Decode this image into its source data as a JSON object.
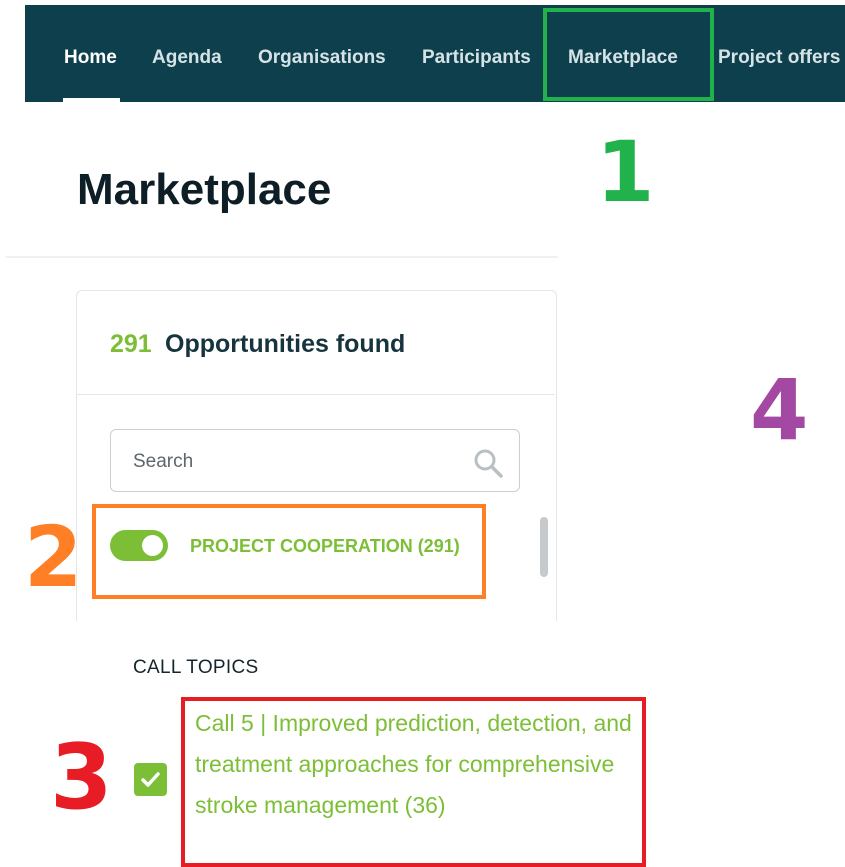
{
  "nav": {
    "items": [
      {
        "label": "Home",
        "active": true
      },
      {
        "label": "Agenda"
      },
      {
        "label": "Organisations"
      },
      {
        "label": "Participants"
      },
      {
        "label": "Marketplace"
      },
      {
        "label": "Project offers"
      }
    ]
  },
  "page": {
    "title": "Marketplace"
  },
  "filters": {
    "count": "291",
    "count_label": "Opportunities found",
    "search": {
      "placeholder": "Search",
      "value": ""
    },
    "toggle": {
      "label": "PROJECT COOPERATION (291)",
      "checked": true
    }
  },
  "call_topics": {
    "heading": "CALL TOPICS",
    "items": [
      {
        "label": "Call 5 | Improved prediction, detection, and treatment approaches for comprehensive stroke management (36)",
        "checked": true
      }
    ]
  },
  "annotations": {
    "markers": [
      "1",
      "2",
      "3",
      "4"
    ],
    "colors": [
      "#22b24c",
      "#ff7f27",
      "#e81c24",
      "#a349a4"
    ]
  },
  "colors": {
    "nav_bg": "#0d3f4d",
    "accent_green": "#7cbf37",
    "title_text": "#0e1e26"
  }
}
